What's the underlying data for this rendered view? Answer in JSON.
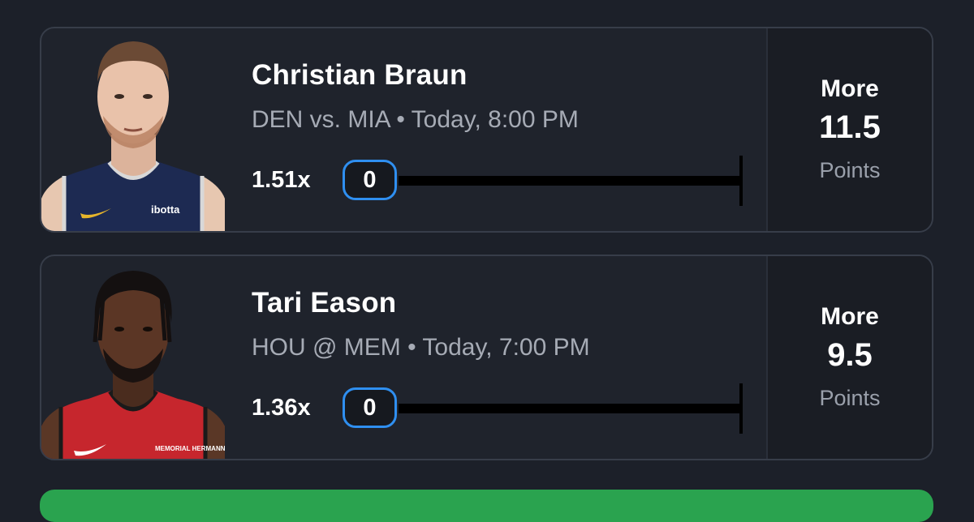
{
  "picks": [
    {
      "player_name": "Christian Braun",
      "game_info": "DEN vs. MIA • Today, 8:00 PM",
      "multiplier": "1.51x",
      "counter_value": "0",
      "direction": "More",
      "line": "11.5",
      "stat": "Points",
      "jersey_text": "ibotta",
      "colors": {
        "jersey": "#1d2a52",
        "trim": "#d8d8d8",
        "accent": "#e7b52b"
      }
    },
    {
      "player_name": "Tari Eason",
      "game_info": "HOU @ MEM • Today, 7:00 PM",
      "multiplier": "1.36x",
      "counter_value": "0",
      "direction": "More",
      "line": "9.5",
      "stat": "Points",
      "jersey_text": "MEMORIAL HERMANN",
      "colors": {
        "jersey": "#c6262d",
        "trim": "#1a1a1a",
        "accent": "#ffffff"
      }
    }
  ],
  "colors": {
    "background": "#1c2029",
    "card": "#1f232c",
    "card_border": "#373d49",
    "counter_border": "#2f8ff0",
    "submit": "#2aa34f"
  }
}
